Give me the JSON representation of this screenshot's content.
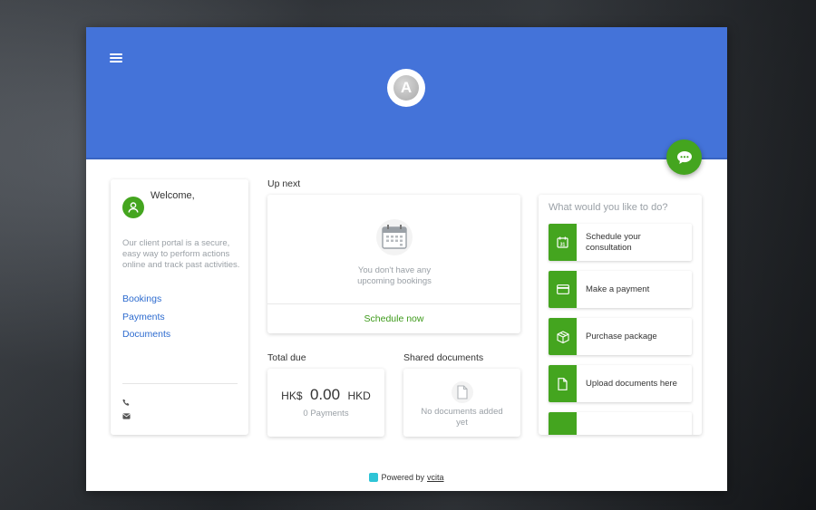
{
  "header": {
    "logo_letter": "A",
    "brand_color": "#4473d9",
    "accent_color": "#44a51f"
  },
  "welcome": {
    "title": "Welcome,",
    "description": "Our client portal is a secure, easy way to perform actions online and track past activities.",
    "nav": [
      {
        "label": "Bookings"
      },
      {
        "label": "Payments"
      },
      {
        "label": "Documents"
      }
    ],
    "contact_icons": [
      "phone-icon",
      "envelope-icon"
    ]
  },
  "upnext": {
    "label": "Up next",
    "empty_text": "You don't have any upcoming bookings",
    "schedule_label": "Schedule now"
  },
  "total_due": {
    "label": "Total due",
    "prefix": "HK$",
    "amount": "0.00",
    "currency": "HKD",
    "payments": "0 Payments"
  },
  "shared_documents": {
    "label": "Shared documents",
    "empty_text": "No documents added yet"
  },
  "actions": {
    "title": "What would you like to do?",
    "items": [
      {
        "label": "Schedule your consultation",
        "icon": "calendar-icon"
      },
      {
        "label": "Make a payment",
        "icon": "credit-card-icon"
      },
      {
        "label": "Purchase package",
        "icon": "package-icon"
      },
      {
        "label": "Upload documents here",
        "icon": "document-icon"
      }
    ]
  },
  "footer": {
    "powered_by": "Powered by",
    "brand": "vcita"
  }
}
